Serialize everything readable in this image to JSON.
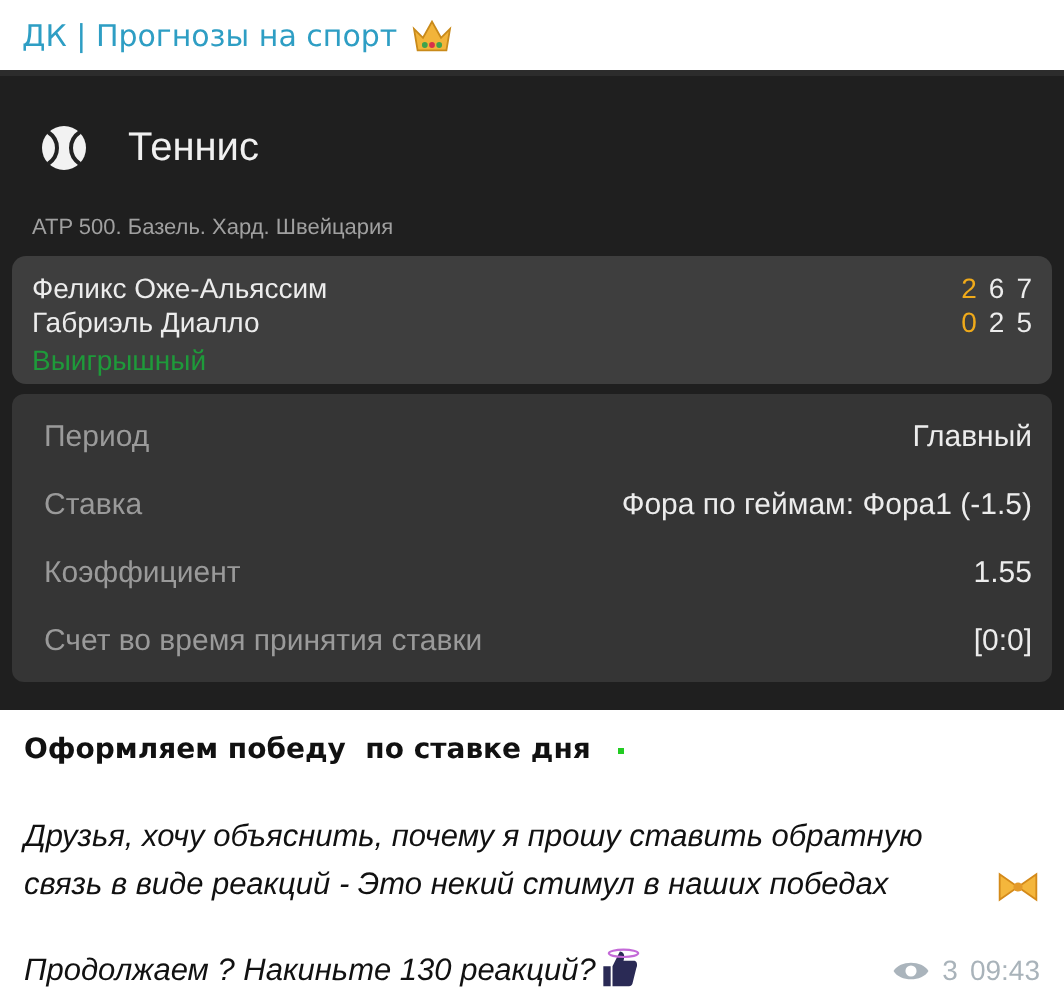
{
  "channel": {
    "title": "ДК | Прогнозы на спорт"
  },
  "bet_card": {
    "sport": "Теннис",
    "tournament": "ATP 500. Базель. Хард. Швейцария",
    "players": [
      {
        "name": "Феликс Оже-Альяссим",
        "scores": [
          {
            "value": "2",
            "highlighted": true
          },
          {
            "value": "6",
            "highlighted": false
          },
          {
            "value": "7",
            "highlighted": false
          }
        ]
      },
      {
        "name": "Габриэль Диалло",
        "scores": [
          {
            "value": "0",
            "highlighted": true
          },
          {
            "value": "2",
            "highlighted": false
          },
          {
            "value": "5",
            "highlighted": false
          }
        ]
      }
    ],
    "result": {
      "label": "Выигрышный",
      "color": "#1e9a3a"
    },
    "details": [
      {
        "label": "Период",
        "value": "Главный"
      },
      {
        "label": "Ставка",
        "value": "Фора по геймам: Фора1 (-1.5)"
      },
      {
        "label": "Коэффициент",
        "value": "1.55"
      },
      {
        "label": "Счет во время принятия ставки",
        "value": "[0:0]"
      }
    ]
  },
  "message": {
    "title": "Оформляем победу  по ставке дня",
    "paragraphs": [
      "Друзья, хочу объяснить, почему я прошу ставить обратную связь в виде реакций - Это некий стимул в наших победах",
      "Продолжаем ? Накиньте 130 реакций?"
    ],
    "views": "3",
    "time": "09:43"
  }
}
